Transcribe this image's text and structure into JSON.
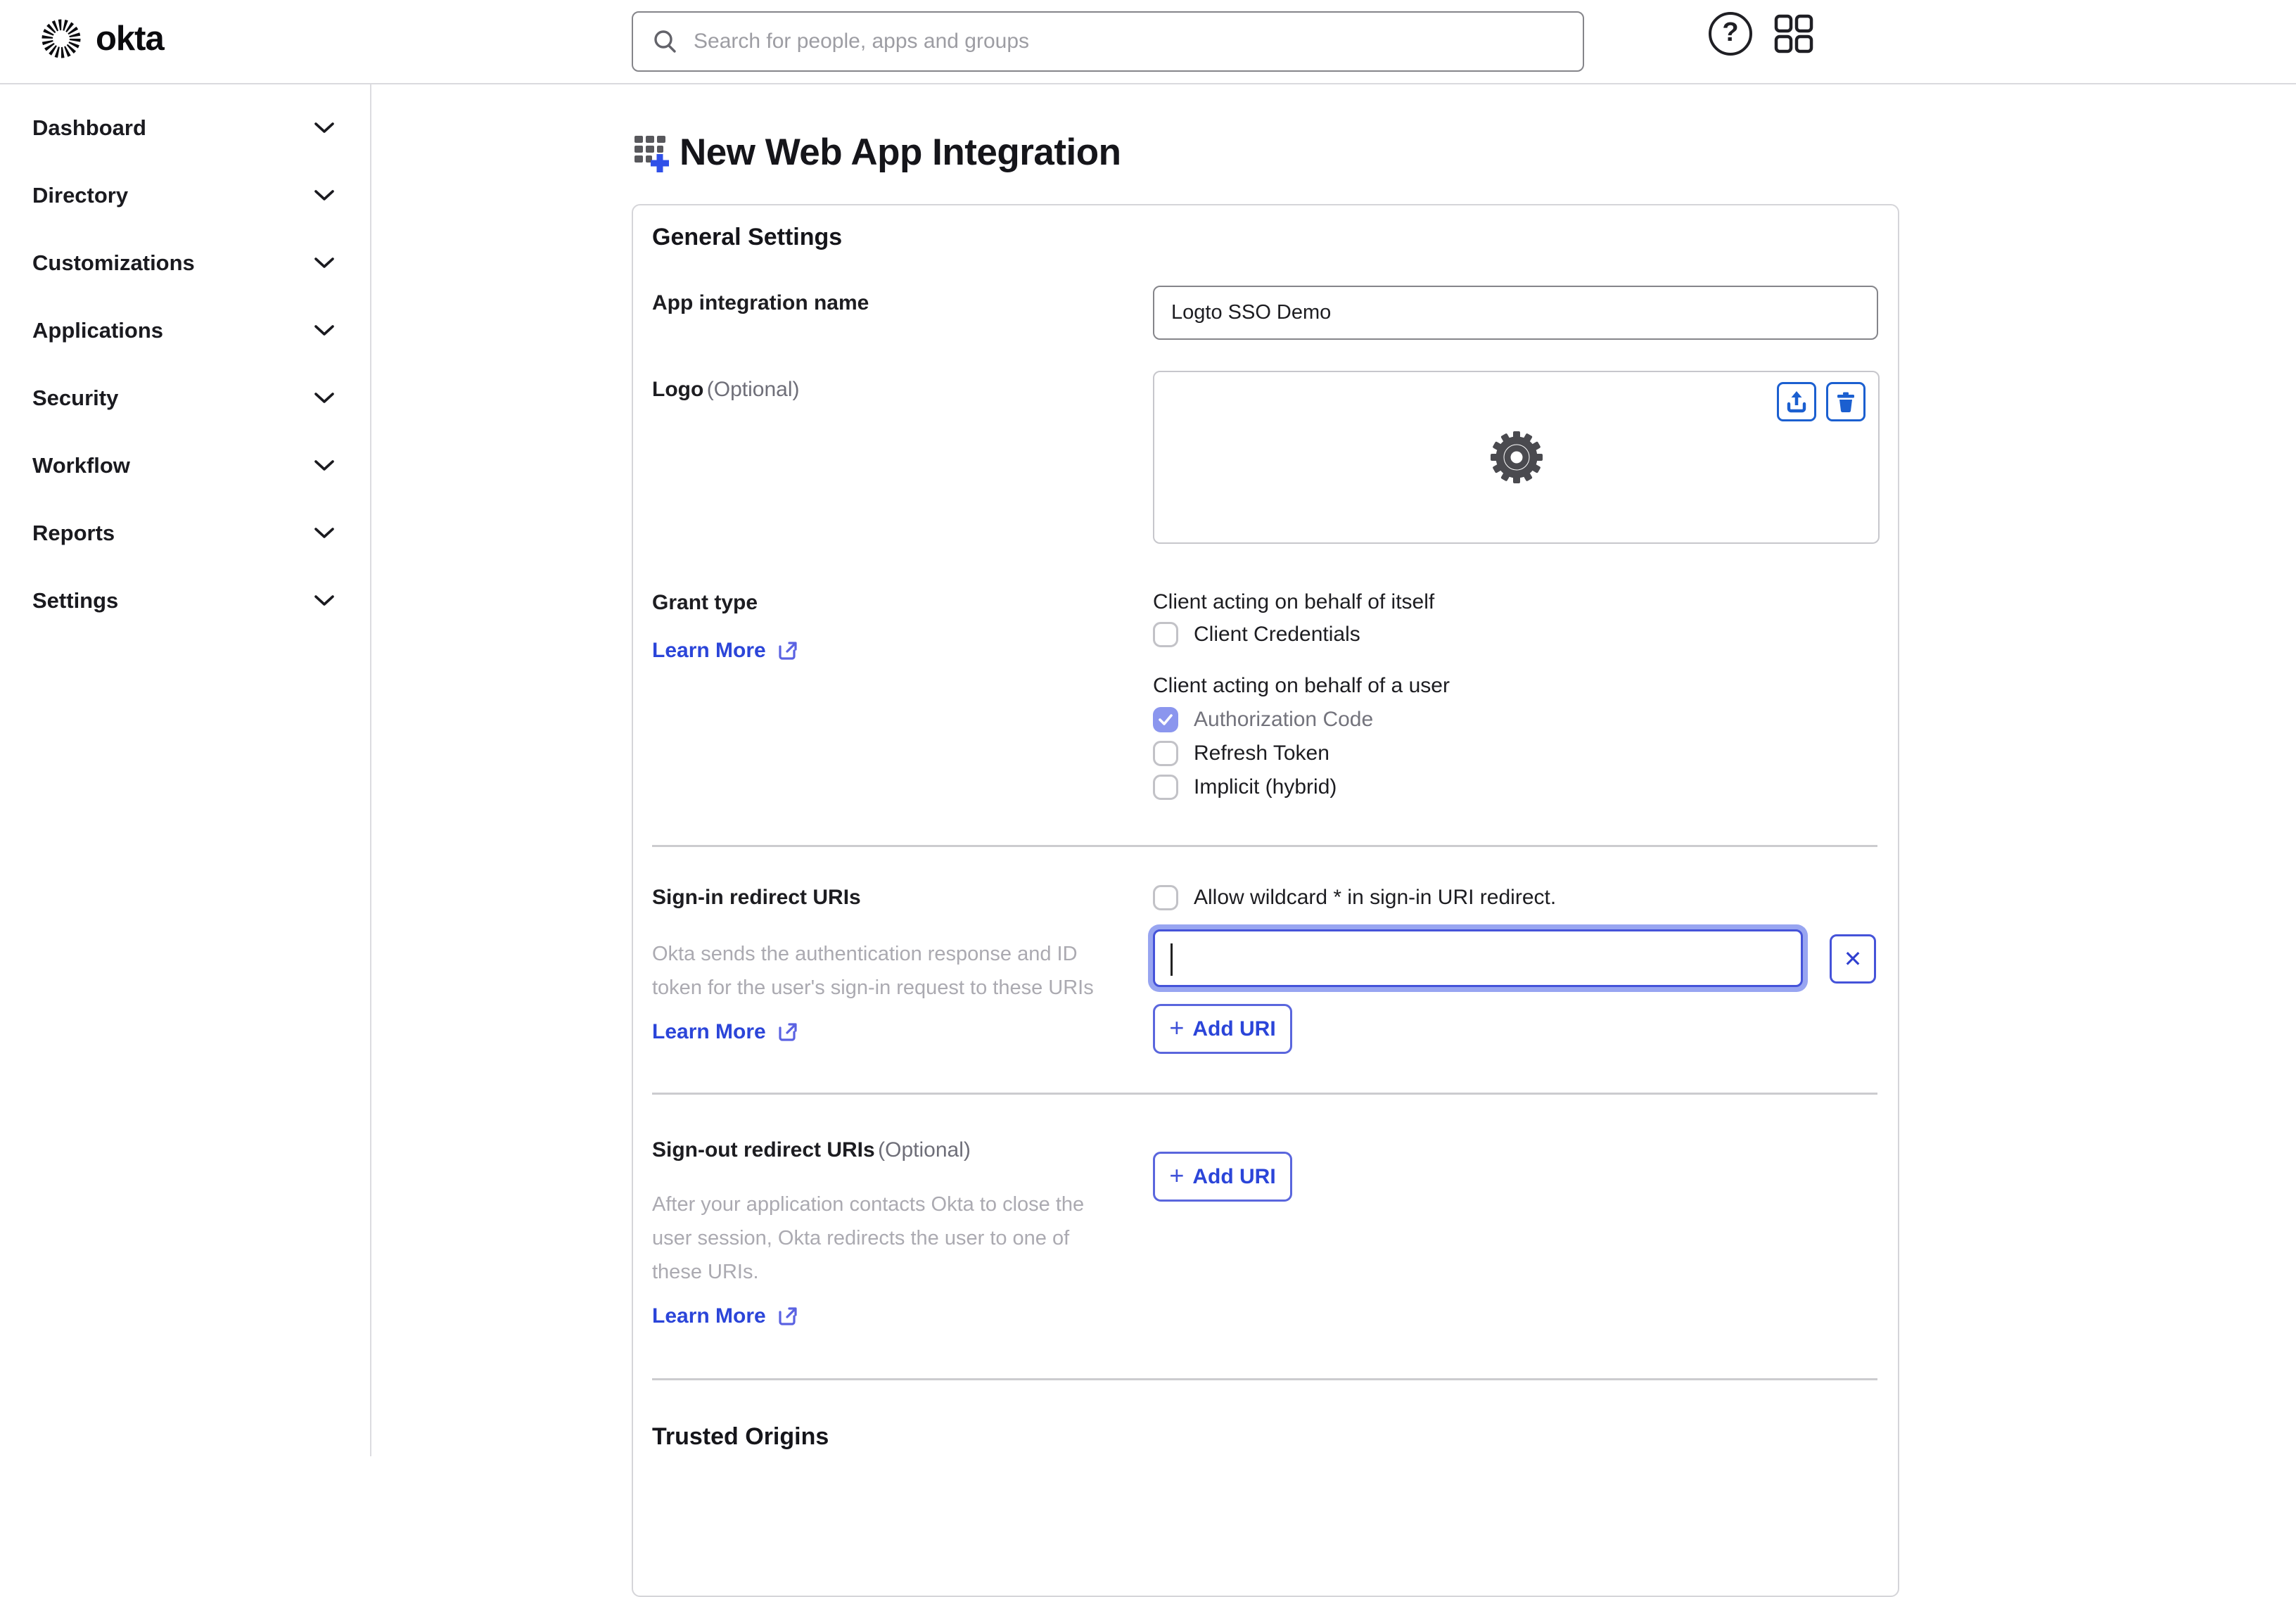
{
  "header": {
    "brand": "okta",
    "search": {
      "placeholder": "Search for people, apps and groups"
    },
    "help_glyph": "?"
  },
  "sidebar": {
    "items": [
      {
        "label": "Dashboard"
      },
      {
        "label": "Directory"
      },
      {
        "label": "Customizations"
      },
      {
        "label": "Applications"
      },
      {
        "label": "Security"
      },
      {
        "label": "Workflow"
      },
      {
        "label": "Reports"
      },
      {
        "label": "Settings"
      }
    ]
  },
  "page": {
    "title": "New Web App Integration",
    "card": {
      "heading": "General Settings",
      "app_name": {
        "label": "App integration name",
        "value": "Logto SSO Demo"
      },
      "logo": {
        "label": "Logo",
        "optional": "(Optional)"
      },
      "grant": {
        "label": "Grant type",
        "learn_more": "Learn More",
        "itself_heading": "Client acting on behalf of itself",
        "itself_options": [
          {
            "label": "Client Credentials",
            "checked": false
          }
        ],
        "user_heading": "Client acting on behalf of a user",
        "user_options": [
          {
            "label": "Authorization Code",
            "checked": true
          },
          {
            "label": "Refresh Token",
            "checked": false
          },
          {
            "label": "Implicit (hybrid)",
            "checked": false
          }
        ]
      },
      "signin": {
        "label": "Sign-in redirect URIs",
        "wildcard_label": "Allow wildcard * in sign-in URI redirect.",
        "wildcard_checked": false,
        "helper": "Okta sends the authentication response and ID token for the user's sign-in request to these URIs",
        "uri_value": "",
        "close_label": "✕",
        "plus": "+",
        "add_uri_label": "Add URI",
        "learn_more": "Learn More"
      },
      "signout": {
        "label": "Sign-out redirect URIs",
        "optional": "(Optional)",
        "helper": "After your application contacts Okta to close the user session, Okta redirects the user to one of these URIs.",
        "plus": "+",
        "add_uri_label": "Add URI",
        "learn_more": "Learn More"
      },
      "trusted_origins_heading": "Trusted Origins"
    }
  },
  "colors": {
    "link_blue": "#2b45d9",
    "icon_button_blue": "#1b5fd0",
    "focus_ring": "#98a5f1",
    "focus_border": "#4553d9",
    "checked_checkbox": "#8b96ee",
    "divider": "#cccccf",
    "helper_text": "#abaab1"
  }
}
